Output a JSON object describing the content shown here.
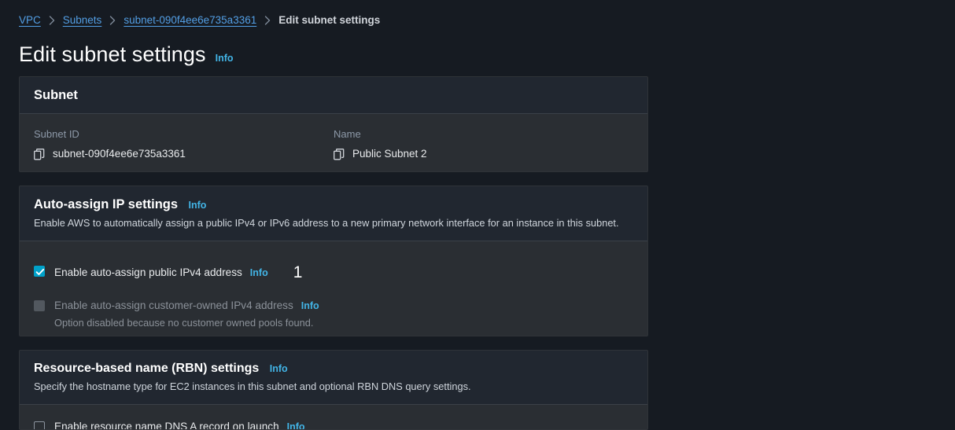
{
  "breadcrumb": {
    "items": [
      {
        "label": "VPC",
        "type": "link"
      },
      {
        "label": "Subnets",
        "type": "link"
      },
      {
        "label": "subnet-090f4ee6e735a3361",
        "type": "link"
      },
      {
        "label": "Edit subnet settings",
        "type": "current"
      }
    ]
  },
  "page": {
    "title": "Edit subnet settings",
    "info_label": "Info"
  },
  "subnet_panel": {
    "title": "Subnet",
    "fields": [
      {
        "label": "Subnet ID",
        "value": "subnet-090f4ee6e735a3361",
        "icon": "copy-icon"
      },
      {
        "label": "Name",
        "value": "Public Subnet 2",
        "icon": "copy-icon"
      }
    ]
  },
  "auto_assign_panel": {
    "title": "Auto-assign IP settings",
    "info_label": "Info",
    "description": "Enable AWS to automatically assign a public IPv4 or IPv6 address to a new primary network interface for an instance in this subnet.",
    "options": [
      {
        "label": "Enable auto-assign public IPv4 address",
        "info_label": "Info",
        "checked": true,
        "disabled": false,
        "annotation": "1",
        "sub_text": ""
      },
      {
        "label": "Enable auto-assign customer-owned IPv4 address",
        "info_label": "Info",
        "checked": false,
        "disabled": true,
        "annotation": "",
        "sub_text": "Option disabled because no customer owned pools found."
      }
    ]
  },
  "rbn_panel": {
    "title": "Resource-based name (RBN) settings",
    "info_label": "Info",
    "description": "Specify the hostname type for EC2 instances in this subnet and optional RBN DNS query settings.",
    "options": [
      {
        "label": "Enable resource name DNS A record on launch",
        "info_label": "Info",
        "checked": false,
        "disabled": false
      }
    ]
  },
  "colors": {
    "page_background": "#161b22",
    "panel_header": "#212730",
    "panel_body": "#2a2e33",
    "link": "#539fe5",
    "info_link": "#42b4e6",
    "checkbox_checked": "#00a1c9",
    "text_primary": "#e9ebed",
    "text_muted": "#8d99a8"
  }
}
